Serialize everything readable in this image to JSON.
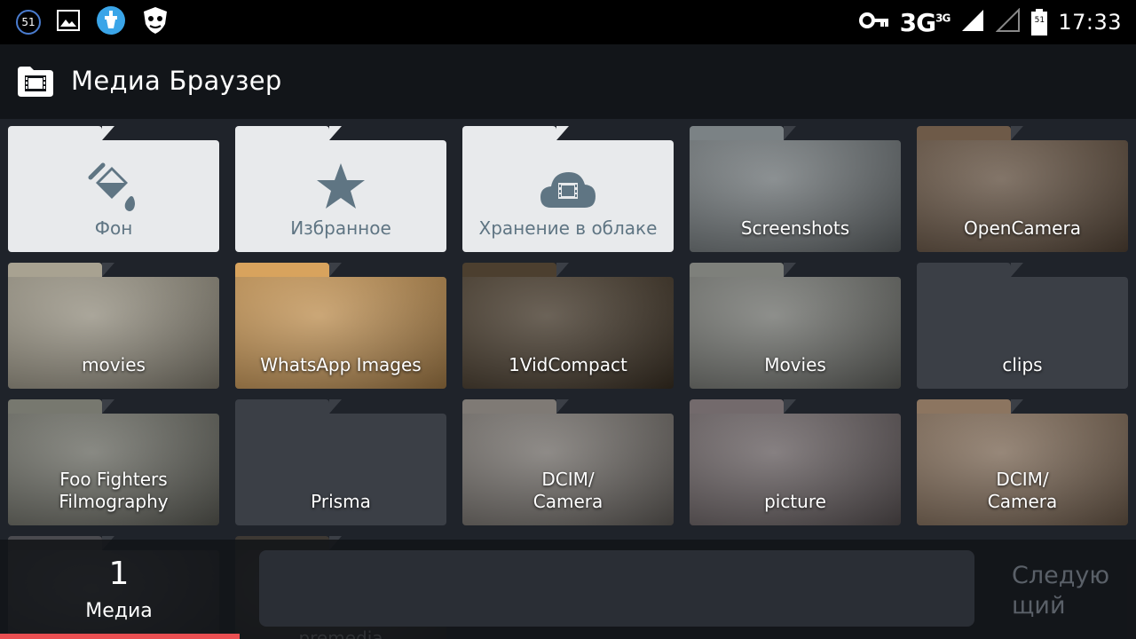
{
  "status_bar": {
    "notification_count": "51",
    "network": "3G",
    "network_sup": "3G",
    "battery_level": "51",
    "time": "17:33"
  },
  "app_bar": {
    "title": "Медиа Браузер",
    "icon": "folder-film-icon"
  },
  "folders": [
    {
      "label": "Фон",
      "style": "light",
      "icon": "paint-bucket-icon"
    },
    {
      "label": "Избранное",
      "style": "light",
      "icon": "star-icon"
    },
    {
      "label": "Хранение в облаке",
      "style": "light",
      "icon": "cloud-film-icon"
    },
    {
      "label": "Screenshots",
      "style": "thumb",
      "color": "#7b8285"
    },
    {
      "label": "OpenCamera",
      "style": "thumb",
      "color": "#6e5a48"
    },
    {
      "label": "movies",
      "style": "thumb",
      "color": "#a8a291"
    },
    {
      "label": "WhatsApp Images",
      "style": "thumb",
      "color": "#d8a35d"
    },
    {
      "label": "1VidCompact",
      "style": "thumb",
      "color": "#4c3f2f"
    },
    {
      "label": "Movies",
      "style": "thumb",
      "color": "#7e807b"
    },
    {
      "label": "clips",
      "style": "dark"
    },
    {
      "label": "Foo Fighters\nFilmography",
      "style": "thumb",
      "color": "#77786f"
    },
    {
      "label": "Prisma",
      "style": "dark"
    },
    {
      "label": "DCIM/\nCamera",
      "style": "thumb",
      "color": "#7f7a75"
    },
    {
      "label": "picture",
      "style": "thumb",
      "color": "#736a6c"
    },
    {
      "label": "DCIM/\nCamera",
      "style": "thumb",
      "color": "#8c7560"
    },
    {
      "label": "",
      "style": "thumb",
      "color": "#4a4a4f"
    },
    {
      "label": "premedia",
      "style": "thumb",
      "color": "#3d3833"
    }
  ],
  "bottom_panel": {
    "page_number": "1",
    "page_label": "Медиа",
    "next_label": "Следую\nщий"
  },
  "colors": {
    "accent": "#ea4f52",
    "folder_light": "#e8eaec",
    "folder_light_text": "#5f7583",
    "folder_dark": "#3b3f46",
    "background": "#1f232a"
  }
}
